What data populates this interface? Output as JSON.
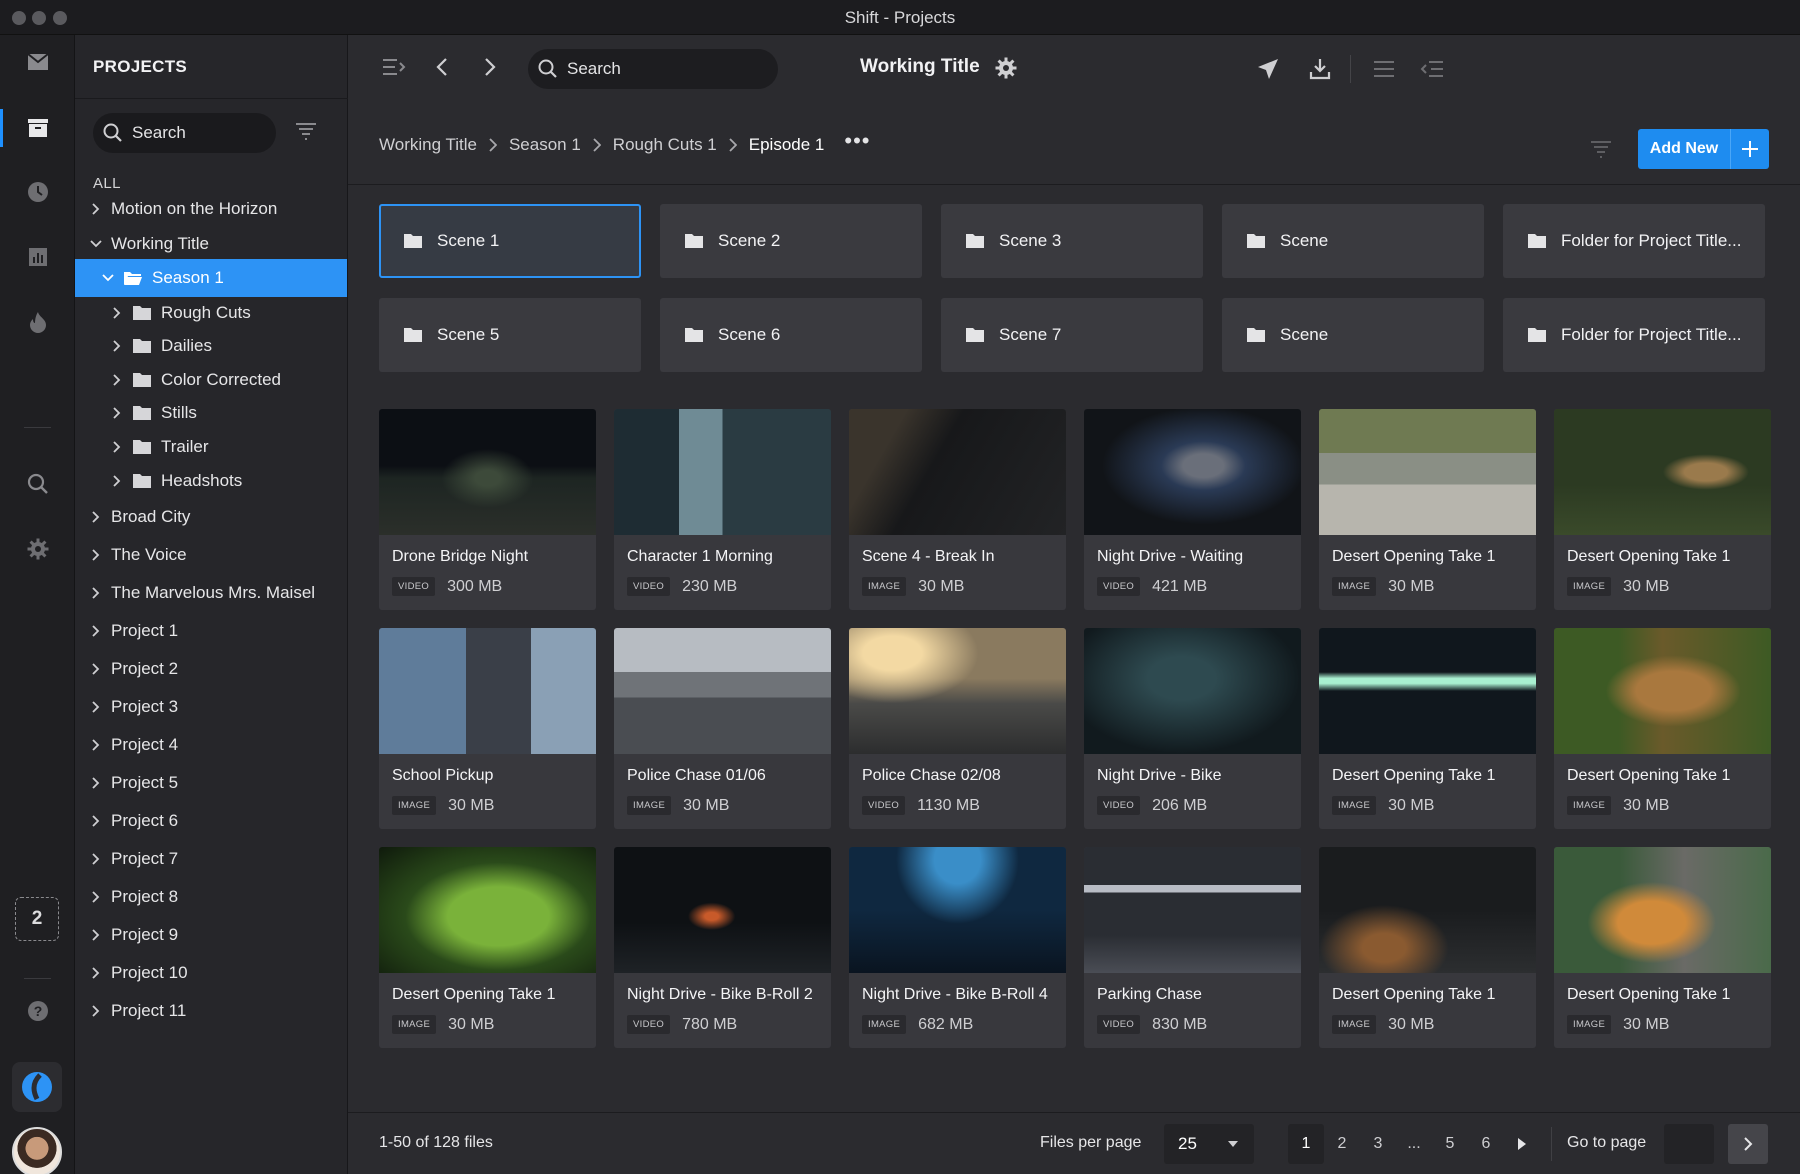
{
  "window": {
    "app": "Shift",
    "separator": "-",
    "section": "Projects"
  },
  "rail": {
    "items": [
      "inbox-icon",
      "projects-icon",
      "history-icon",
      "analytics-icon",
      "flame-icon",
      "search-icon",
      "gear-icon"
    ],
    "badge": "2",
    "help": "help-icon"
  },
  "sidebar": {
    "title": "PROJECTS",
    "search_label": "Search",
    "all_label": "ALL",
    "tree": [
      {
        "label": "Motion on the Horizon",
        "level": 0,
        "state": "collapsed"
      },
      {
        "label": "Working Title",
        "level": 0,
        "state": "expanded"
      },
      {
        "label": "Season 1",
        "level": 1,
        "state": "expanded",
        "folder": true,
        "selected": true
      },
      {
        "label": "Rough Cuts",
        "level": 2,
        "state": "collapsed",
        "folder": true
      },
      {
        "label": "Dailies",
        "level": 2,
        "state": "collapsed",
        "folder": true
      },
      {
        "label": "Color Corrected",
        "level": 2,
        "state": "collapsed",
        "folder": true
      },
      {
        "label": "Stills",
        "level": 2,
        "state": "collapsed",
        "folder": true
      },
      {
        "label": "Trailer",
        "level": 2,
        "state": "collapsed",
        "folder": true
      },
      {
        "label": "Headshots",
        "level": 2,
        "state": "collapsed",
        "folder": true
      },
      {
        "label": "Broad City",
        "level": 0,
        "state": "collapsed"
      },
      {
        "label": "The Voice",
        "level": 0,
        "state": "collapsed"
      },
      {
        "label": "The Marvelous Mrs. Maisel",
        "level": 0,
        "state": "collapsed"
      },
      {
        "label": "Project 1",
        "level": 0,
        "state": "collapsed"
      },
      {
        "label": "Project 2",
        "level": 0,
        "state": "collapsed"
      },
      {
        "label": "Project 3",
        "level": 0,
        "state": "collapsed"
      },
      {
        "label": "Project 4",
        "level": 0,
        "state": "collapsed"
      },
      {
        "label": "Project 5",
        "level": 0,
        "state": "collapsed"
      },
      {
        "label": "Project 6",
        "level": 0,
        "state": "collapsed"
      },
      {
        "label": "Project 7",
        "level": 0,
        "state": "collapsed"
      },
      {
        "label": "Project 8",
        "level": 0,
        "state": "collapsed"
      },
      {
        "label": "Project 9",
        "level": 0,
        "state": "collapsed"
      },
      {
        "label": "Project 10",
        "level": 0,
        "state": "collapsed"
      },
      {
        "label": "Project 11",
        "level": 0,
        "state": "collapsed"
      }
    ]
  },
  "toolbar": {
    "search_label": "Search",
    "title": "Working Title"
  },
  "breadcrumb": [
    "Working Title",
    "Season 1",
    "Rough Cuts 1",
    "Episode 1"
  ],
  "breadcrumb_more": "•••",
  "add_new_label": "Add New",
  "folders": [
    {
      "name": "Scene 1",
      "selected": true
    },
    {
      "name": "Scene 2"
    },
    {
      "name": "Scene 3"
    },
    {
      "name": "Scene"
    },
    {
      "name": "Folder for Project Title..."
    },
    {
      "name": "Scene 5"
    },
    {
      "name": "Scene 6"
    },
    {
      "name": "Scene 7"
    },
    {
      "name": "Scene"
    },
    {
      "name": "Folder for Project Title..."
    }
  ],
  "files": [
    {
      "name": "Drone Bridge Night",
      "kind": "VIDEO",
      "size": "300 MB",
      "thumb": "night-road"
    },
    {
      "name": "Character 1 Morning",
      "kind": "VIDEO",
      "size": "230 MB",
      "thumb": "window-silhouette"
    },
    {
      "name": "Scene 4 - Break In",
      "kind": "IMAGE",
      "size": "30 MB",
      "thumb": "dark-figure"
    },
    {
      "name": "Night Drive - Waiting",
      "kind": "VIDEO",
      "size": "421 MB",
      "thumb": "driver"
    },
    {
      "name": "Desert Opening Take 1",
      "kind": "IMAGE",
      "size": "30 MB",
      "thumb": "skatepark"
    },
    {
      "name": "Desert Opening Take 1",
      "kind": "IMAGE",
      "size": "30 MB",
      "thumb": "deer"
    },
    {
      "name": "School Pickup",
      "kind": "IMAGE",
      "size": "30 MB",
      "thumb": "girl-building"
    },
    {
      "name": "Police Chase 01/06",
      "kind": "IMAGE",
      "size": "30 MB",
      "thumb": "cars-road"
    },
    {
      "name": "Police Chase 02/08",
      "kind": "VIDEO",
      "size": "1130 MB",
      "thumb": "car-sunset"
    },
    {
      "name": "Night Drive - Bike",
      "kind": "VIDEO",
      "size": "206 MB",
      "thumb": "bike-fog"
    },
    {
      "name": "Desert Opening Take 1",
      "kind": "IMAGE",
      "size": "30 MB",
      "thumb": "helmet-neon"
    },
    {
      "name": "Desert Opening Take 1",
      "kind": "IMAGE",
      "size": "30 MB",
      "thumb": "giraffe"
    },
    {
      "name": "Desert Opening Take 1",
      "kind": "IMAGE",
      "size": "30 MB",
      "thumb": "frog"
    },
    {
      "name": "Night Drive - Bike B-Roll 2",
      "kind": "VIDEO",
      "size": "780 MB",
      "thumb": "bike-night"
    },
    {
      "name": "Night Drive - Bike B-Roll 4",
      "kind": "IMAGE",
      "size": "682 MB",
      "thumb": "bike-blue"
    },
    {
      "name": "Parking Chase",
      "kind": "VIDEO",
      "size": "830 MB",
      "thumb": "parking"
    },
    {
      "name": "Desert Opening Take 1",
      "kind": "IMAGE",
      "size": "30 MB",
      "thumb": "road-curve"
    },
    {
      "name": "Desert Opening Take 1",
      "kind": "IMAGE",
      "size": "30 MB",
      "thumb": "tiger"
    }
  ],
  "footer": {
    "count": "1-50 of 128 files",
    "files_per_page_label": "Files per page",
    "files_per_page": "25",
    "pages": [
      "1",
      "2",
      "3",
      "...",
      "5",
      "6"
    ],
    "current_page": "1",
    "goto_label": "Go to page"
  },
  "colors": {
    "accent": "#2d93f5",
    "background": "#2b2b2f",
    "sidebar": "#26262a"
  }
}
